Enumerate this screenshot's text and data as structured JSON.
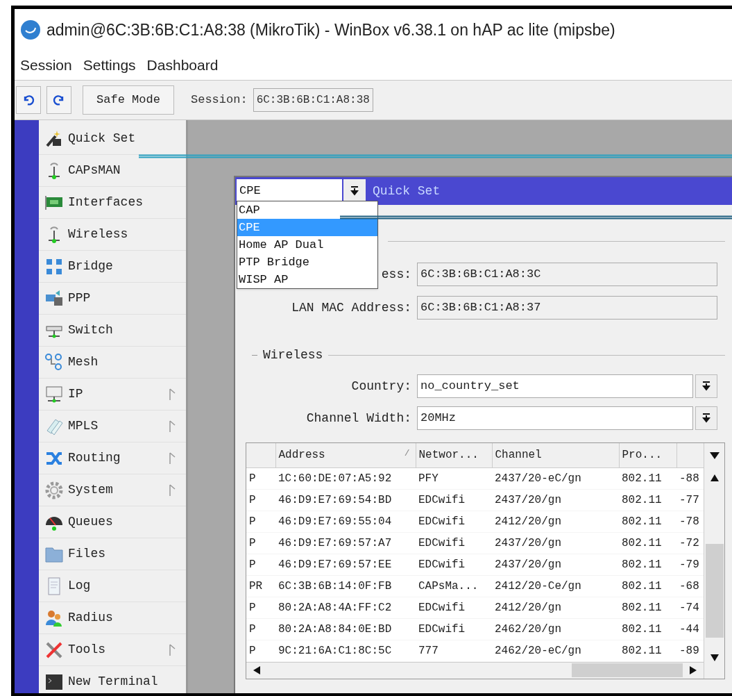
{
  "window": {
    "title": "admin@6C:3B:6B:C1:A8:38 (MikroTik) - WinBox v6.38.1 on hAP ac lite (mipsbe)"
  },
  "menu": [
    "Session",
    "Settings",
    "Dashboard"
  ],
  "toolbar": {
    "safe_mode": "Safe Mode",
    "session_label": "Session:",
    "session_value": "6C:3B:6B:C1:A8:38"
  },
  "sidebar": {
    "items": [
      {
        "label": "Quick Set",
        "has_submenu": false
      },
      {
        "label": "CAPsMAN",
        "has_submenu": false
      },
      {
        "label": "Interfaces",
        "has_submenu": false
      },
      {
        "label": "Wireless",
        "has_submenu": false
      },
      {
        "label": "Bridge",
        "has_submenu": false
      },
      {
        "label": "PPP",
        "has_submenu": false
      },
      {
        "label": "Switch",
        "has_submenu": false
      },
      {
        "label": "Mesh",
        "has_submenu": false
      },
      {
        "label": "IP",
        "has_submenu": true
      },
      {
        "label": "MPLS",
        "has_submenu": true
      },
      {
        "label": "Routing",
        "has_submenu": true
      },
      {
        "label": "System",
        "has_submenu": true
      },
      {
        "label": "Queues",
        "has_submenu": false
      },
      {
        "label": "Files",
        "has_submenu": false
      },
      {
        "label": "Log",
        "has_submenu": false
      },
      {
        "label": "Radius",
        "has_submenu": false
      },
      {
        "label": "Tools",
        "has_submenu": true
      },
      {
        "label": "New Terminal",
        "has_submenu": false
      }
    ]
  },
  "quick_set": {
    "title": "Quick Set",
    "mode_value": "CPE",
    "mode_options": [
      {
        "label": "CAP",
        "selected": false
      },
      {
        "label": "CPE",
        "selected": true
      },
      {
        "label": "Home AP Dual",
        "selected": false
      },
      {
        "label": "PTP Bridge",
        "selected": false
      },
      {
        "label": "WISP AP",
        "selected": false
      }
    ],
    "fields": [
      {
        "label": "ess:",
        "value": "6C:3B:6B:C1:A8:3C"
      },
      {
        "label": "LAN MAC Address:",
        "value": "6C:3B:6B:C1:A8:37"
      }
    ],
    "wireless_group": "Wireless",
    "wireless_fields": [
      {
        "label": "Country:",
        "value": "no_country_set"
      },
      {
        "label": "Channel Width:",
        "value": "20MHz"
      }
    ],
    "table": {
      "columns": [
        "Address",
        "Networ...",
        "Channel",
        "Pro..."
      ],
      "sort_mark": "/",
      "rows": [
        {
          "flags": "P",
          "address": "1C:60:DE:07:A5:92",
          "network": "PFY",
          "channel": "2437/20-eC/gn",
          "protocol": "802.11",
          "column_6": "-88"
        },
        {
          "flags": "P",
          "address": "46:D9:E7:69:54:BD",
          "network": "EDCwifi",
          "channel": "2437/20/gn",
          "protocol": "802.11",
          "column_6": "-77"
        },
        {
          "flags": "P",
          "address": "46:D9:E7:69:55:04",
          "network": "EDCwifi",
          "channel": "2412/20/gn",
          "protocol": "802.11",
          "column_6": "-78"
        },
        {
          "flags": "P",
          "address": "46:D9:E7:69:57:A7",
          "network": "EDCwifi",
          "channel": "2437/20/gn",
          "protocol": "802.11",
          "column_6": "-72"
        },
        {
          "flags": "P",
          "address": "46:D9:E7:69:57:EE",
          "network": "EDCwifi",
          "channel": "2437/20/gn",
          "protocol": "802.11",
          "column_6": "-79"
        },
        {
          "flags": "PR",
          "address": "6C:3B:6B:14:0F:FB",
          "network": "CAPsMa...",
          "channel": "2412/20-Ce/gn",
          "protocol": "802.11",
          "column_6": "-68"
        },
        {
          "flags": "P",
          "address": "80:2A:A8:4A:FF:C2",
          "network": "EDCwifi",
          "channel": "2412/20/gn",
          "protocol": "802.11",
          "column_6": "-74"
        },
        {
          "flags": "P",
          "address": "80:2A:A8:84:0E:BD",
          "network": "EDCwifi",
          "channel": "2462/20/gn",
          "protocol": "802.11",
          "column_6": "-44"
        },
        {
          "flags": "P",
          "address": "9C:21:6A:C1:8C:5C",
          "network": "777",
          "channel": "2462/20-eC/gn",
          "protocol": "802.11",
          "column_6": "-89"
        }
      ]
    }
  }
}
